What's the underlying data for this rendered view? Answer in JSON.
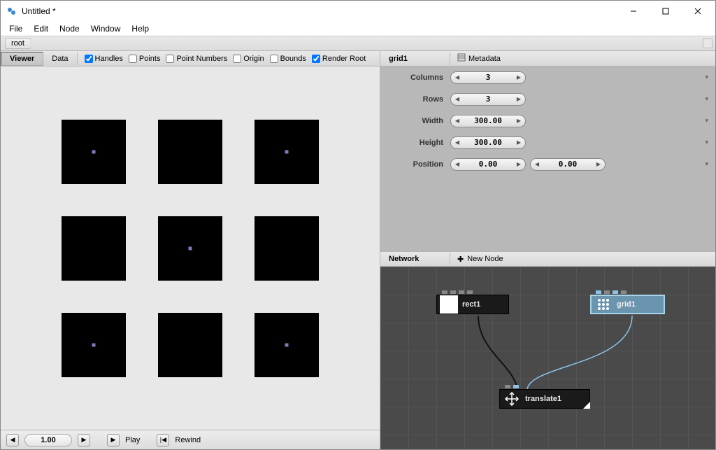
{
  "window": {
    "title": "Untitled *"
  },
  "menu": {
    "file": "File",
    "edit": "Edit",
    "node": "Node",
    "window": "Window",
    "help": "Help"
  },
  "breadcrumb": {
    "root": "root"
  },
  "viewerTabs": {
    "viewer": "Viewer",
    "data": "Data"
  },
  "viewerChecks": {
    "handles": "Handles",
    "points": "Points",
    "pointNumbers": "Point Numbers",
    "origin": "Origin",
    "bounds": "Bounds",
    "renderRoot": "Render Root"
  },
  "footer": {
    "zoom": "1.00",
    "play": "Play",
    "rewind": "Rewind"
  },
  "inspector": {
    "selected": "grid1",
    "metadata": "Metadata",
    "rows": {
      "columns": {
        "label": "Columns",
        "value": "3"
      },
      "rowsP": {
        "label": "Rows",
        "value": "3"
      },
      "width": {
        "label": "Width",
        "value": "300.00"
      },
      "height": {
        "label": "Height",
        "value": "300.00"
      },
      "position": {
        "label": "Position",
        "x": "0.00",
        "y": "0.00"
      }
    }
  },
  "network": {
    "title": "Network",
    "newNode": "New Node",
    "nodes": {
      "rect1": "rect1",
      "grid1": "grid1",
      "translate1": "translate1"
    }
  }
}
